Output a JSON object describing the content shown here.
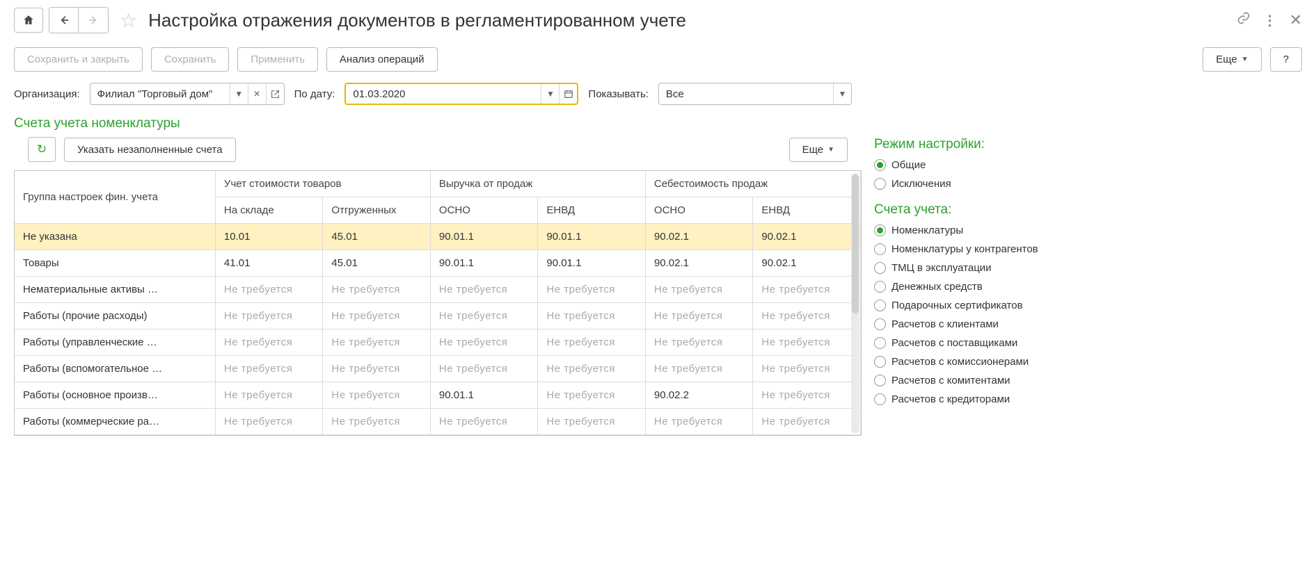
{
  "title": "Настройка отражения документов в регламентированном учете",
  "toolbar": {
    "save_close": "Сохранить и закрыть",
    "save": "Сохранить",
    "apply": "Применить",
    "analyze": "Анализ операций",
    "more": "Еще",
    "help": "?"
  },
  "filters": {
    "org_label": "Организация:",
    "org_value": "Филиал \"Торговый дом\"",
    "date_label": "По дату:",
    "date_value": "01.03.2020",
    "show_label": "Показывать:",
    "show_value": "Все"
  },
  "section_title": "Счета учета номенклатуры",
  "sub_toolbar": {
    "fill_empty": "Указать незаполненные счета",
    "more": "Еще"
  },
  "table": {
    "headers": {
      "group": "Группа настроек фин. учета",
      "cost": "Учет стоимости товаров",
      "cost_sub": [
        "На складе",
        "Отгруженных"
      ],
      "revenue": "Выручка от продаж",
      "rev_sub": [
        "ОСНО",
        "ЕНВД"
      ],
      "cogs": "Себестоимость продаж",
      "cogs_sub": [
        "ОСНО",
        "ЕНВД"
      ]
    },
    "not_required": "Не требуется",
    "rows": [
      {
        "group": "Не указана",
        "c1": "10.01",
        "c2": "45.01",
        "c3": "90.01.1",
        "c4": "90.01.1",
        "c5": "90.02.1",
        "c6": "90.02.1"
      },
      {
        "group": "Товары",
        "c1": "41.01",
        "c2": "45.01",
        "c3": "90.01.1",
        "c4": "90.01.1",
        "c5": "90.02.1",
        "c6": "90.02.1"
      },
      {
        "group": "Нематериальные активы …",
        "c1": "NR",
        "c2": "NR",
        "c3": "NR",
        "c4": "NR",
        "c5": "NR",
        "c6": "NR"
      },
      {
        "group": "Работы (прочие расходы)",
        "c1": "NR",
        "c2": "NR",
        "c3": "NR",
        "c4": "NR",
        "c5": "NR",
        "c6": "NR"
      },
      {
        "group": "Работы (управленческие …",
        "c1": "NR",
        "c2": "NR",
        "c3": "NR",
        "c4": "NR",
        "c5": "NR",
        "c6": "NR"
      },
      {
        "group": "Работы (вспомогательное …",
        "c1": "NR",
        "c2": "NR",
        "c3": "NR",
        "c4": "NR",
        "c5": "NR",
        "c6": "NR"
      },
      {
        "group": "Работы (основное произв…",
        "c1": "NR",
        "c2": "NR",
        "c3": "90.01.1",
        "c4": "NR",
        "c5": "90.02.2",
        "c6": "NR"
      },
      {
        "group": "Работы (коммерческие ра…",
        "c1": "NR",
        "c2": "NR",
        "c3": "NR",
        "c4": "NR",
        "c5": "NR",
        "c6": "NR"
      }
    ]
  },
  "side": {
    "mode_heading": "Режим настройки:",
    "mode_options": [
      {
        "label": "Общие",
        "selected": true
      },
      {
        "label": "Исключения",
        "selected": false
      }
    ],
    "accounts_heading": "Счета учета:",
    "accounts_options": [
      {
        "label": "Номенклатуры",
        "selected": true
      },
      {
        "label": "Номенклатуры у контрагентов",
        "selected": false
      },
      {
        "label": "ТМЦ в эксплуатации",
        "selected": false
      },
      {
        "label": "Денежных средств",
        "selected": false
      },
      {
        "label": "Подарочных сертификатов",
        "selected": false
      },
      {
        "label": "Расчетов с клиентами",
        "selected": false
      },
      {
        "label": "Расчетов с поставщиками",
        "selected": false
      },
      {
        "label": "Расчетов с комиссионерами",
        "selected": false
      },
      {
        "label": "Расчетов с комитентами",
        "selected": false
      },
      {
        "label": "Расчетов с кредиторами",
        "selected": false
      }
    ]
  }
}
